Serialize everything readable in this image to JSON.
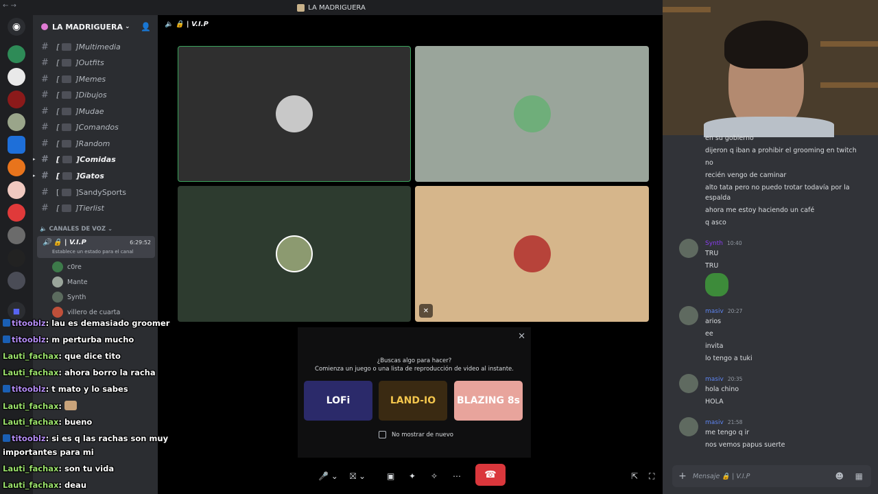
{
  "window": {
    "title": "LA MADRIGUERA"
  },
  "server": {
    "name": "LA MADRIGUERA"
  },
  "channels": [
    {
      "name": "Multimedia",
      "bold": false
    },
    {
      "name": "Outfits",
      "bold": false
    },
    {
      "name": "Memes",
      "bold": false
    },
    {
      "name": "Dibujos",
      "bold": false
    },
    {
      "name": "Mudae",
      "bold": false
    },
    {
      "name": "Comandos",
      "bold": false
    },
    {
      "name": "Random",
      "bold": false
    },
    {
      "name": "Comidas",
      "bold": true
    },
    {
      "name": "Gatos",
      "bold": true
    },
    {
      "name": "SandySports",
      "bold": false
    },
    {
      "name": "Tierlist",
      "bold": false
    }
  ],
  "voice_category": "CANALES DE VOZ",
  "voice_channel": {
    "name": "V.I.P",
    "time": "6:29:52",
    "status_prompt": "Establece un estado para el canal"
  },
  "voice_users": [
    "c0re",
    "Mante",
    "Synth",
    "villero de cuarta"
  ],
  "vc_header": "V.I.P",
  "activity": {
    "question": "¿Buscas algo para hacer?",
    "subtitle": "Comienza un juego o una lista de reproducción de video al instante.",
    "cards": [
      "LOFi",
      "LAND-IO",
      "BLAZING 8s"
    ],
    "checkbox_label": "No mostrar de nuevo"
  },
  "chat": {
    "intro_lines": [
      "en su gobierno",
      "dijeron q iban a prohibir el grooming en twitch",
      "no",
      "recién vengo de caminar",
      "alto tata pero no puedo trotar todavía por la",
      "espalda",
      "ahora me estoy haciendo un café",
      "q asco"
    ],
    "groups": [
      {
        "author": "Synth",
        "time": "10:40",
        "lines": [
          "TRU",
          "TRU"
        ]
      },
      {
        "author": "masiv",
        "time": "20:27",
        "lines": [
          "arios",
          "ee",
          "invita",
          "lo tengo a tuki"
        ]
      },
      {
        "author": "masiv",
        "time": "20:35",
        "lines": [
          "hola chino",
          "HOLA"
        ]
      },
      {
        "author": "masiv",
        "time": "21:58",
        "lines": [
          "me tengo q ir",
          "nos vemos papus suerte"
        ]
      }
    ],
    "input_placeholder": "Mensaje 🔒 | V.I.P"
  },
  "overlay_chat": [
    {
      "user": "titooblz",
      "text": ": lau es demasiado groomer"
    },
    {
      "user": "titooblz",
      "text": ": m perturba mucho"
    },
    {
      "user": "Lauti_fachax",
      "text": ": que dice tito"
    },
    {
      "user": "Lauti_fachax",
      "text": ": ahora borro la racha"
    },
    {
      "user": "titooblz",
      "text": ": t mato y lo sabes"
    },
    {
      "user": "Lauti_fachax",
      "text": ":"
    },
    {
      "user": "Lauti_fachax",
      "text": ": bueno"
    },
    {
      "user": "titooblz",
      "text": ": si es q las rachas son muy"
    },
    {
      "user": "",
      "text": "importantes para mi"
    },
    {
      "user": "Lauti_fachax",
      "text": ": son tu vida"
    },
    {
      "user": "Lauti_fachax",
      "text": ": deau"
    }
  ],
  "colors": {
    "accent_green": "#3ba55d",
    "end_call": "#da373c",
    "author_masiv": "#5d84f2",
    "author_synth": "#8a3df0"
  }
}
